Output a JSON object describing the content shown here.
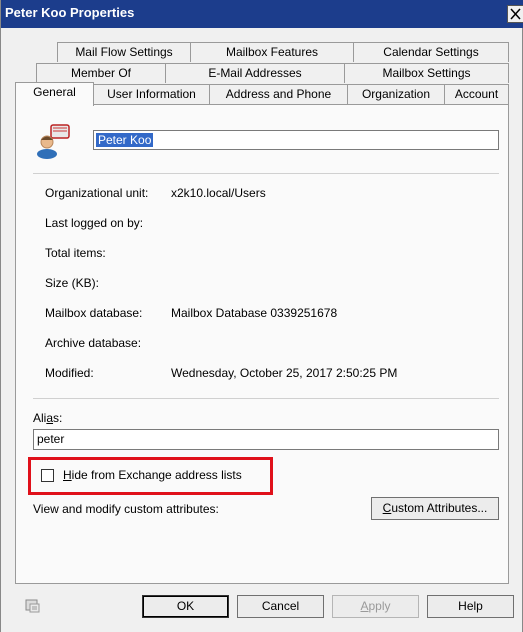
{
  "window": {
    "title": "Peter Koo Properties",
    "close_glyph": "✕"
  },
  "tabs": {
    "row1": [
      "Mail Flow Settings",
      "Mailbox Features",
      "Calendar Settings"
    ],
    "row2": [
      "Member Of",
      "E-Mail Addresses",
      "Mailbox Settings"
    ],
    "row3": [
      "General",
      "User Information",
      "Address and Phone",
      "Organization",
      "Account"
    ],
    "active": "General"
  },
  "general": {
    "display_name": "Peter Koo",
    "fields": [
      {
        "label": "Organizational unit:",
        "value": "x2k10.local/Users"
      },
      {
        "label": "Last logged on by:",
        "value": ""
      },
      {
        "label": "Total items:",
        "value": ""
      },
      {
        "label": "Size (KB):",
        "value": ""
      },
      {
        "label": "Mailbox database:",
        "value": "Mailbox Database 0339251678"
      },
      {
        "label": "Archive database:",
        "value": ""
      },
      {
        "label": "Modified:",
        "value": "Wednesday, October 25, 2017 2:50:25 PM"
      }
    ],
    "alias_label_pre": "Ali",
    "alias_label_key": "a",
    "alias_label_post": "s:",
    "alias_value": "peter",
    "hide_key": "H",
    "hide_label_rest": "ide from Exchange address lists",
    "hide_checked": false,
    "custom_attr_text": "View and modify custom attributes:",
    "custom_attr_button_key": "C",
    "custom_attr_button_rest": "ustom Attributes..."
  },
  "footer": {
    "ok": "OK",
    "cancel": "Cancel",
    "apply_key": "A",
    "apply_rest": "pply",
    "help": "Help"
  },
  "colors": {
    "titlebar": "#1c3d8c",
    "highlight": "#e0101a",
    "selection": "#3369c8"
  }
}
